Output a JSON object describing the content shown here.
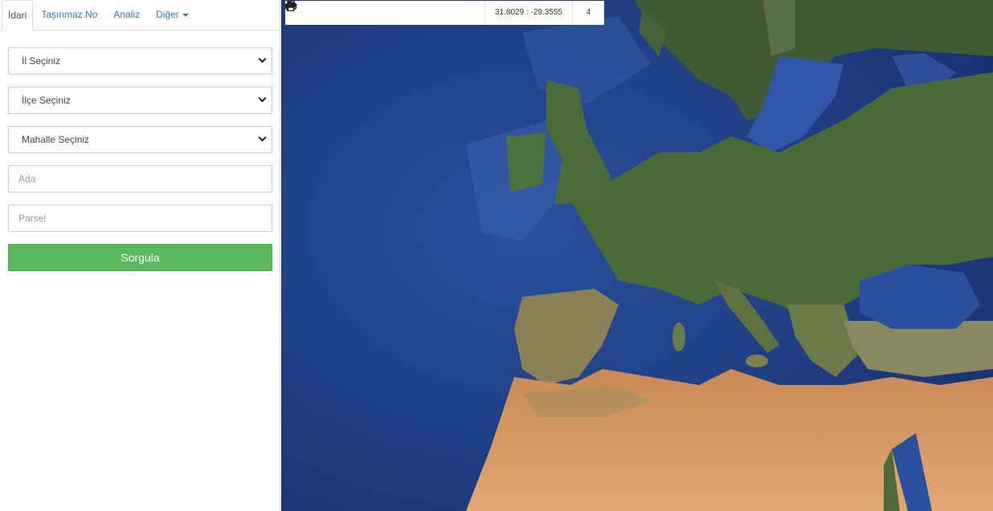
{
  "tabs": [
    {
      "label": "İdari",
      "active": true
    },
    {
      "label": "Taşınmaz No",
      "active": false
    },
    {
      "label": "Analiz",
      "active": false
    },
    {
      "label": "Diğer",
      "active": false
    }
  ],
  "form": {
    "province_select": "İl Seçiniz",
    "district_select": "İlçe Seçiniz",
    "neighborhood_select": "Mahalle Seçiniz",
    "block_placeholder": "Ada",
    "parcel_placeholder": "Parsel",
    "query_button": "Sorgula"
  },
  "toolbar": {
    "icons": [
      "zoom-in-icon",
      "zoom-out-icon",
      "refresh-icon",
      "locate-icon",
      "info-icon",
      "star-icon",
      "measure-icon",
      "print-icon"
    ],
    "coordinates": "31.8029 : -29.3555",
    "zoom_level": "4"
  },
  "colors": {
    "accent_green": "#5cb85c",
    "link_blue": "#337ab7",
    "sea_deep": "#1d3a7d",
    "land_green": "#3d5a2c",
    "desert": "#d9a06a"
  }
}
